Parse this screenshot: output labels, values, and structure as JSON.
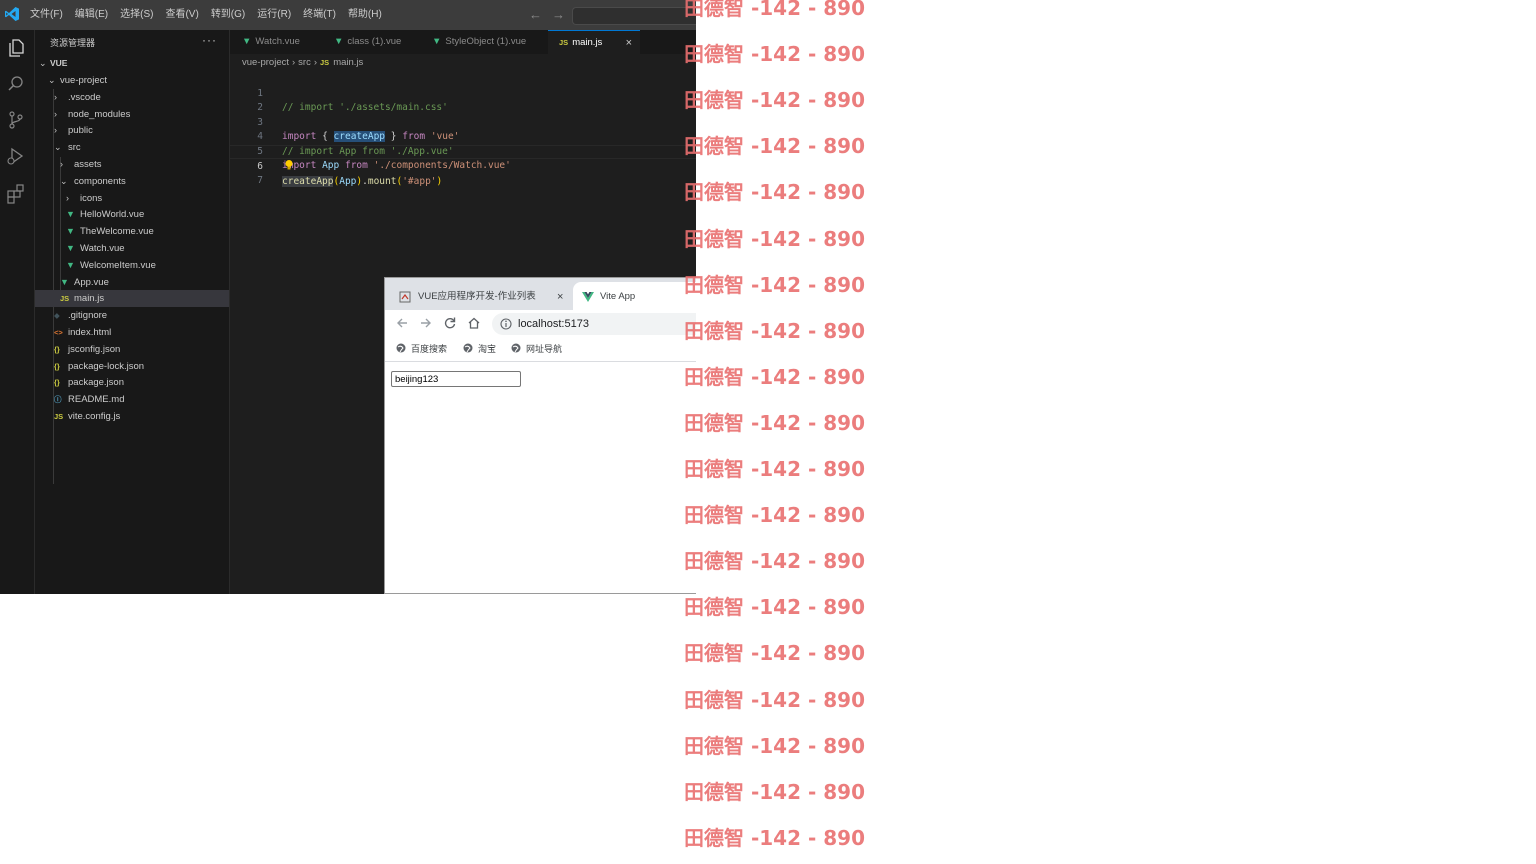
{
  "vscode": {
    "menu": [
      "文件(F)",
      "编辑(E)",
      "选择(S)",
      "查看(V)",
      "转到(G)",
      "运行(R)",
      "终端(T)",
      "帮助(H)"
    ],
    "explorer_title": "资源管理器",
    "explorer_more": "···",
    "workspace": "VUE",
    "tree": [
      {
        "label": "vue-project",
        "twist": "⌄",
        "icon": ""
      },
      {
        "label": ".vscode",
        "twist": "›",
        "icon": ""
      },
      {
        "label": "node_modules",
        "twist": "›",
        "icon": ""
      },
      {
        "label": "public",
        "twist": "›",
        "icon": ""
      },
      {
        "label": "src",
        "twist": "⌄",
        "icon": ""
      },
      {
        "label": "assets",
        "twist": "›",
        "icon": ""
      },
      {
        "label": "components",
        "twist": "⌄",
        "icon": ""
      },
      {
        "label": "icons",
        "twist": "›",
        "icon": ""
      },
      {
        "label": "HelloWorld.vue",
        "twist": "",
        "icon": "vue"
      },
      {
        "label": "TheWelcome.vue",
        "twist": "",
        "icon": "vue"
      },
      {
        "label": "Watch.vue",
        "twist": "",
        "icon": "vue"
      },
      {
        "label": "WelcomeItem.vue",
        "twist": "",
        "icon": "vue"
      },
      {
        "label": "App.vue",
        "twist": "",
        "icon": "vue"
      },
      {
        "label": "main.js",
        "twist": "",
        "icon": "js"
      },
      {
        "label": ".gitignore",
        "twist": "",
        "icon": "git"
      },
      {
        "label": "index.html",
        "twist": "",
        "icon": "html"
      },
      {
        "label": "jsconfig.json",
        "twist": "",
        "icon": "json"
      },
      {
        "label": "package-lock.json",
        "twist": "",
        "icon": "json"
      },
      {
        "label": "package.json",
        "twist": "",
        "icon": "json"
      },
      {
        "label": "README.md",
        "twist": "",
        "icon": "info"
      },
      {
        "label": "vite.config.js",
        "twist": "",
        "icon": "js"
      }
    ],
    "icon_text": {
      "js": "JS",
      "json": "{}",
      "html": "<>",
      "git": "◆",
      "info": "ⓘ"
    },
    "tabs": [
      {
        "label": "Watch.vue",
        "icon": "vue"
      },
      {
        "label": "class (1).vue",
        "icon": "vue"
      },
      {
        "label": "StyleObject (1).vue",
        "icon": "vue"
      },
      {
        "label": "main.js",
        "icon": "js",
        "close": "×"
      }
    ],
    "breadcrumb": {
      "part1": "vue-project",
      "part2": "src",
      "file_icon": "JS",
      "file": "main.js"
    },
    "line_numbers": [
      "1",
      "2",
      "3",
      "4",
      "5",
      "6",
      "7"
    ],
    "code": {
      "l1": "// import './assets/main.css'",
      "l3_import": "import",
      "l3_ob": "{",
      "l3_name": "createApp",
      "l3_cb": "}",
      "l3_from": "from",
      "l3_mod": "'vue'",
      "l4": "// import App from './App.vue'",
      "l5_import": "import",
      "l5_name": "App",
      "l5_from": "from",
      "l5_mod": "'./components/Watch.vue'",
      "l6_fn": "createApp",
      "l6_op": "(",
      "l6_arg": "App",
      "l6_cp": ")",
      "l6_dot": ".",
      "l6_mount": "mount",
      "l6_op2": "(",
      "l6_sel": "'#app'",
      "l6_cp2": ")"
    }
  },
  "browser": {
    "tab1_title": "VUE应用程序开发-作业列表",
    "tab1_close": "×",
    "tab2_title": "Vite App",
    "url": "localhost:5173",
    "bookmarks": [
      "百度搜索",
      "淘宝",
      "网址导航"
    ],
    "input_value": "beijing123"
  },
  "watermark": {
    "text": "田德智 -142 - 890",
    "color": "#e96f6f",
    "repeat_count": 19
  },
  "colors": {
    "vue_green": "#41b883",
    "js_yellow": "#cbcb41",
    "json_yellow": "#cbcb41",
    "html_orange": "#e37933",
    "git_gray": "#41535b",
    "info_blue": "#519aba",
    "accent": "#0078d4"
  }
}
